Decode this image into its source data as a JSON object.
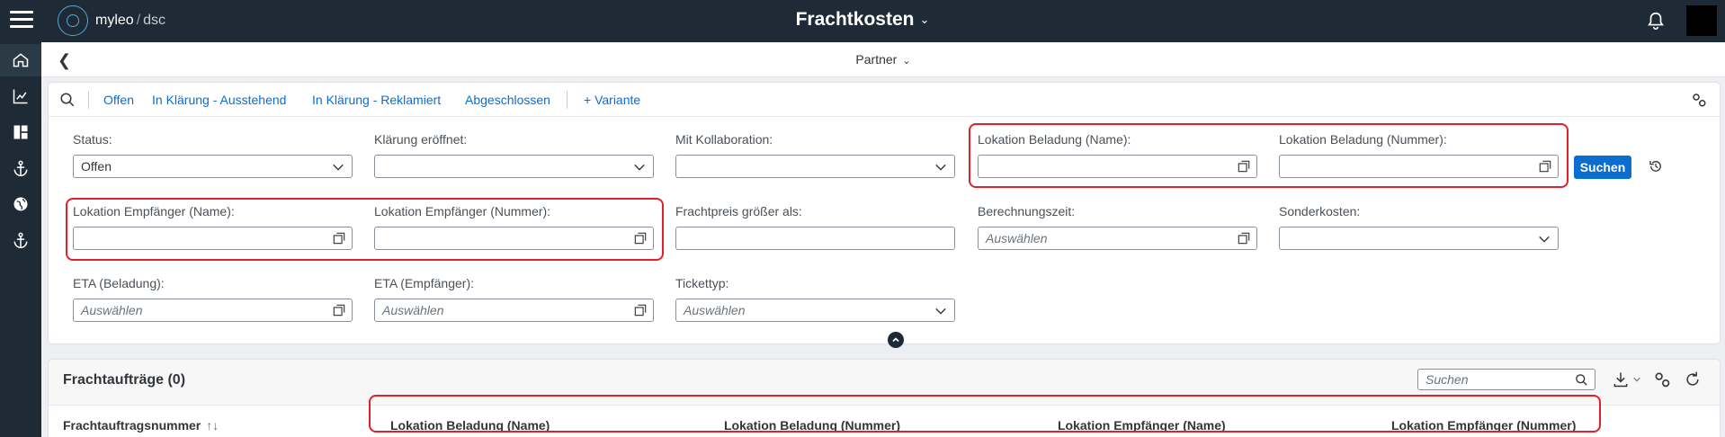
{
  "shell": {
    "brand": "myleo",
    "brand_separator": "/",
    "brand_sub": "dsc",
    "title": "Frachtkosten"
  },
  "subheader": {
    "title": "Partner"
  },
  "variant_bar": {
    "tabs": [
      "Offen",
      "In Klärung - Ausstehend",
      "In Klärung - Reklamiert",
      "Abgeschlossen"
    ],
    "add_variant": "+ Variante"
  },
  "filters": {
    "status": {
      "label": "Status:",
      "value": "Offen"
    },
    "klaerung": {
      "label": "Klärung eröffnet:",
      "value": ""
    },
    "kollaboration": {
      "label": "Mit Kollaboration:",
      "value": ""
    },
    "lok_bel_name": {
      "label": "Lokation Beladung (Name):",
      "value": ""
    },
    "lok_bel_nummer": {
      "label": "Lokation Beladung (Nummer):",
      "value": ""
    },
    "lok_emp_name": {
      "label": "Lokation Empfänger (Name):",
      "value": ""
    },
    "lok_emp_nummer": {
      "label": "Lokation Empfänger (Nummer):",
      "value": ""
    },
    "frachtpreis": {
      "label": "Frachtpreis größer als:",
      "value": ""
    },
    "berechnungszeit": {
      "label": "Berechnungszeit:",
      "placeholder": "Auswählen"
    },
    "sonderkosten": {
      "label": "Sonderkosten:",
      "value": ""
    },
    "eta_beladung": {
      "label": "ETA (Beladung):",
      "placeholder": "Auswählen"
    },
    "eta_empfaenger": {
      "label": "ETA (Empfänger):",
      "placeholder": "Auswählen"
    },
    "tickettyp": {
      "label": "Tickettyp:",
      "placeholder": "Auswählen"
    },
    "search_button": "Suchen"
  },
  "table": {
    "title": "Frachtaufträge (0)",
    "search_placeholder": "Suchen",
    "columns": [
      "Frachtauftragsnummer",
      "Lokation Beladung (Name)",
      "Lokation Beladung (Nummer)",
      "Lokation Empfänger (Name)",
      "Lokation Empfänger (Nummer)"
    ]
  },
  "colors": {
    "shell_bg": "#1e2a35",
    "accent": "#0a6ed1",
    "highlight": "#e0202a"
  }
}
